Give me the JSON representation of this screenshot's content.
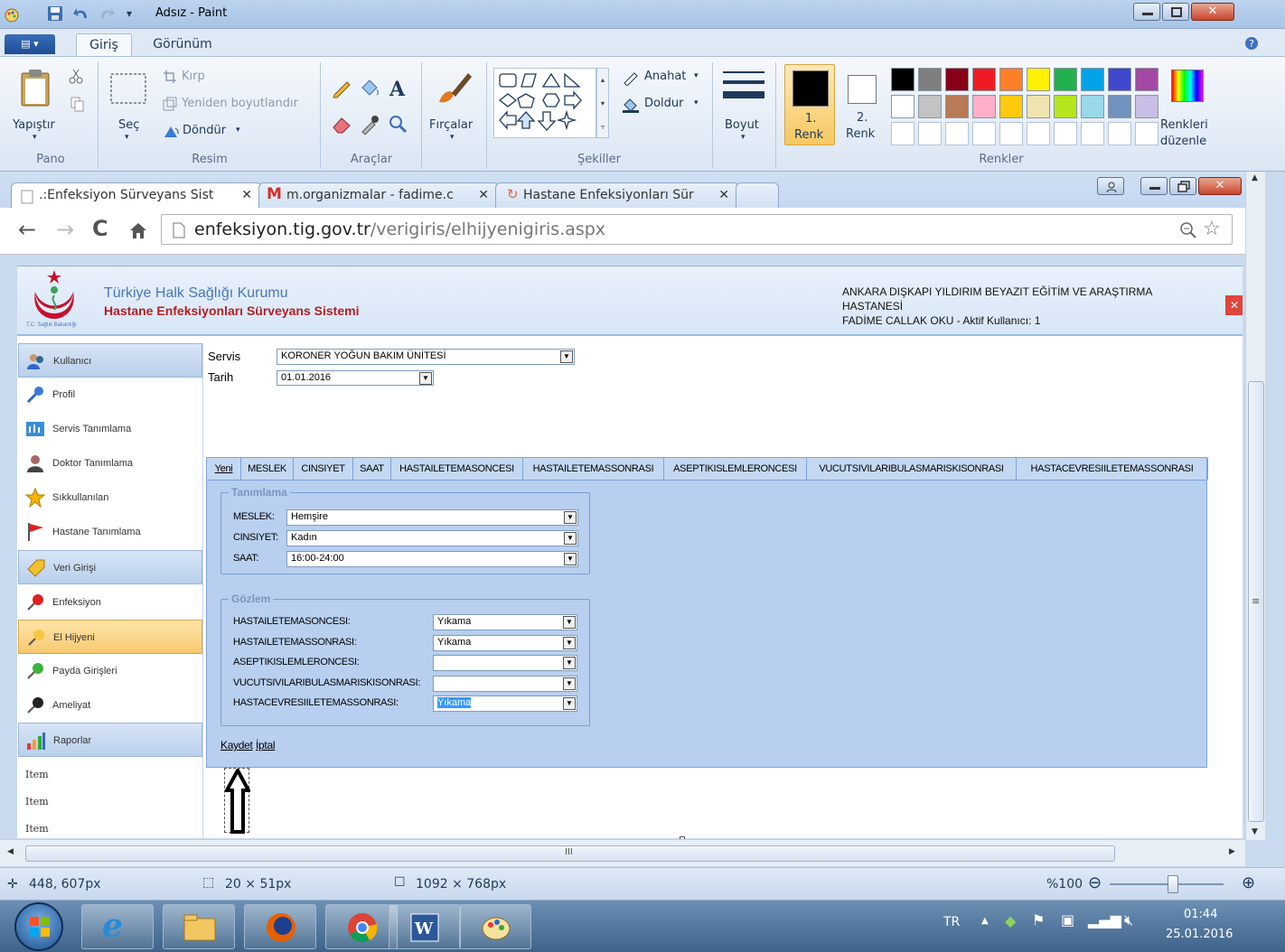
{
  "window": {
    "title": "Adsız - Paint"
  },
  "ribbon": {
    "file_btn": "▤ ▾",
    "tabs": [
      "Giriş",
      "Görünüm"
    ],
    "clipboard": {
      "paste": "Yapıştır",
      "group": "Pano"
    },
    "image": {
      "select": "Seç",
      "crop": "Kırp",
      "resize": "Yeniden boyutlandır",
      "rotate": "Döndür",
      "group": "Resim"
    },
    "tools": {
      "group": "Araçlar"
    },
    "brushes": "Fırçalar",
    "shapes": {
      "outline": "Anahat",
      "fill": "Doldur",
      "group": "Şekiller"
    },
    "size": "Boyut",
    "color1": "1.\nRenk",
    "color2": "2.\nRenk",
    "color1_l1": "1.",
    "color1_l2": "Renk",
    "color2_l1": "2.",
    "color2_l2": "Renk",
    "edit_colors_l1": "Renkleri",
    "edit_colors_l2": "düzenle",
    "colors_group": "Renkler",
    "palette_row1": [
      "#000000",
      "#7f7f7f",
      "#880015",
      "#ed1c24",
      "#ff7f27",
      "#fff200",
      "#22b14c",
      "#00a2e8",
      "#3f48cc",
      "#a349a4"
    ],
    "palette_row2": [
      "#ffffff",
      "#c3c3c3",
      "#b97a57",
      "#ffaec9",
      "#ffc90e",
      "#efe4b0",
      "#b5e61d",
      "#99d9ea",
      "#7092be",
      "#c8bfe7"
    ]
  },
  "browser": {
    "tabs": [
      ".:Enfeksiyon Sürveyans Sist",
      "m.organizmalar - fadime.c",
      "Hastane Enfeksiyonları Sür"
    ],
    "url_host": "enfeksiyon.tig.gov.tr",
    "url_path": "/verigiris/elhijyenigiris.aspx"
  },
  "site": {
    "logo_caption": "T.C. Sağlık Bakanlığı",
    "title1": "Türkiye Halk Sağlığı Kurumu",
    "title2": "Hastane Enfeksiyonları Sürveyans Sistemi",
    "hospital_l1": "ANKARA DIŞKAPI YILDIRIM BEYAZIT EĞİTİM VE ARAŞTIRMA",
    "hospital_l2": "HASTANESİ",
    "user": "FADİME CALLAK OKU - Aktif Kullanıcı: 1"
  },
  "menu": [
    {
      "label": "Kullanıcı",
      "type": "header"
    },
    {
      "label": "Profil"
    },
    {
      "label": "Servis Tanımlama"
    },
    {
      "label": "Doktor Tanımlama"
    },
    {
      "label": "Sıkkullanılan"
    },
    {
      "label": "Hastane Tanımlama"
    },
    {
      "label": "Veri Girişi",
      "type": "header"
    },
    {
      "label": "Enfeksiyon"
    },
    {
      "label": "El Hijyeni",
      "type": "selected"
    },
    {
      "label": "Payda Girişleri"
    },
    {
      "label": "Ameliyat"
    },
    {
      "label": "Raporlar",
      "type": "header"
    },
    {
      "label": "Item"
    },
    {
      "label": "Item"
    },
    {
      "label": "Item"
    }
  ],
  "form": {
    "servis_label": "Servis",
    "servis_value": "KORONER YOĞUN BAKIM ÜNİTESİ",
    "tarih_label": "Tarih",
    "tarih_value": "01.01.2016",
    "tabs": [
      "Yeni",
      "MESLEK",
      "CINSIYET",
      "SAAT",
      "HASTAILETEMASONCESI",
      "HASTAILETEMASSONRASI",
      "ASEPTIKISLEMLERONCESI",
      "VUCUTSIVILARIBULASMARISKISONRASI",
      "HASTACEVRESIILETEMASSONRASI"
    ],
    "tanimlama": {
      "legend": "Tanımlama",
      "fields": [
        {
          "label": "MESLEK:",
          "value": "Hemşire"
        },
        {
          "label": "CINSIYET:",
          "value": "Kadın"
        },
        {
          "label": "SAAT:",
          "value": "16:00-24:00"
        }
      ]
    },
    "gozlem": {
      "legend": "Gözlem",
      "fields": [
        {
          "label": "HASTAILETEMASONCESI:",
          "value": "Yıkama"
        },
        {
          "label": "HASTAILETEMASSONRASI:",
          "value": "Yıkama"
        },
        {
          "label": "ASEPTIKISLEMLERONCESI:",
          "value": ""
        },
        {
          "label": "VUCUTSIVILARIBULASMARISKISONRASI:",
          "value": ""
        },
        {
          "label": "HASTACEVRESIILETEMASSONRASI:",
          "value": "Yıkama"
        }
      ]
    },
    "save": "Kaydet",
    "cancel": "İptal"
  },
  "hscroll_grip": "III",
  "status": {
    "cursor": "448, 607px",
    "selection": "20 × 51px",
    "image_size": "1092 × 768px",
    "zoom": "%100"
  },
  "taskbar": {
    "lang": "TR",
    "time": "01:44",
    "date": "25.01.2016"
  },
  "colors": {
    "accent_blue": "#4a77b9",
    "brand_red": "#b31f24",
    "panel_blue": "#b8cff0"
  }
}
